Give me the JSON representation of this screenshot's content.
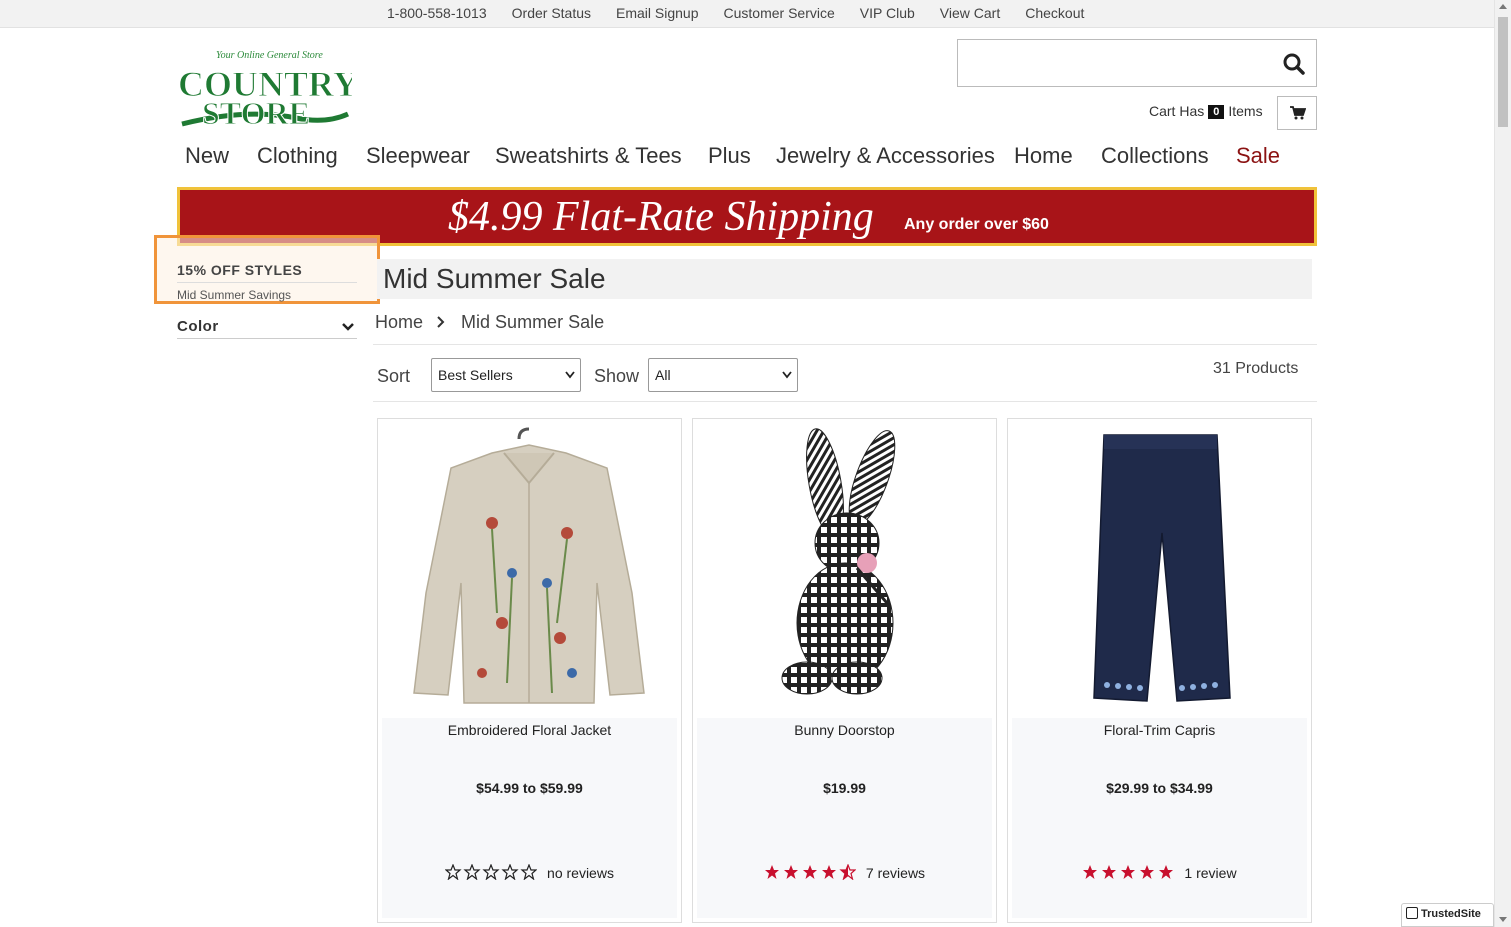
{
  "util_links": [
    "1-800-558-1013",
    "Order Status",
    "Email Signup",
    "Customer Service",
    "VIP Club",
    "View Cart",
    "Checkout"
  ],
  "logo": {
    "tagline": "Your Online General Store",
    "name_line1": "COUNTRY",
    "name_line2": "STORE"
  },
  "search": {
    "placeholder": ""
  },
  "cart": {
    "prefix": "Cart Has",
    "count": "0",
    "suffix": "Items"
  },
  "nav": [
    "New",
    "Clothing",
    "Sleepwear",
    "Sweatshirts & Tees",
    "Plus",
    "Jewelry & Accessories",
    "Home",
    "Collections",
    "Sale"
  ],
  "promo": {
    "headline": "$4.99 Flat-Rate Shipping",
    "subtext": "Any order over $60"
  },
  "sidebar": {
    "heading": "15% OFF STYLES",
    "subheading": "Mid Summer Savings",
    "filter_color": "Color"
  },
  "page": {
    "title": "Mid Summer Sale"
  },
  "breadcrumb": {
    "home": "Home",
    "current": "Mid Summer Sale"
  },
  "toolbar": {
    "sort_label": "Sort",
    "sort_value": "Best Sellers",
    "show_label": "Show",
    "show_value": "All",
    "product_count": "31 Products"
  },
  "products": [
    {
      "name": "Embroidered Floral Jacket",
      "price": "$54.99 to $59.99",
      "rating": 0,
      "reviews": "no reviews"
    },
    {
      "name": "Bunny Doorstop",
      "price": "$19.99",
      "rating": 4.5,
      "reviews": "7 reviews"
    },
    {
      "name": "Floral-Trim Capris",
      "price": "$29.99 to $34.99",
      "rating": 5,
      "reviews": "1 review"
    }
  ],
  "colors": {
    "accent_red": "#a81418",
    "sale_red": "#8b1212",
    "star_red": "#c8102e",
    "banner_border": "#f0c23a",
    "highlight": "#f0943a",
    "logo_green": "#1f7a33"
  },
  "trusted_badge": "TrustedSite"
}
